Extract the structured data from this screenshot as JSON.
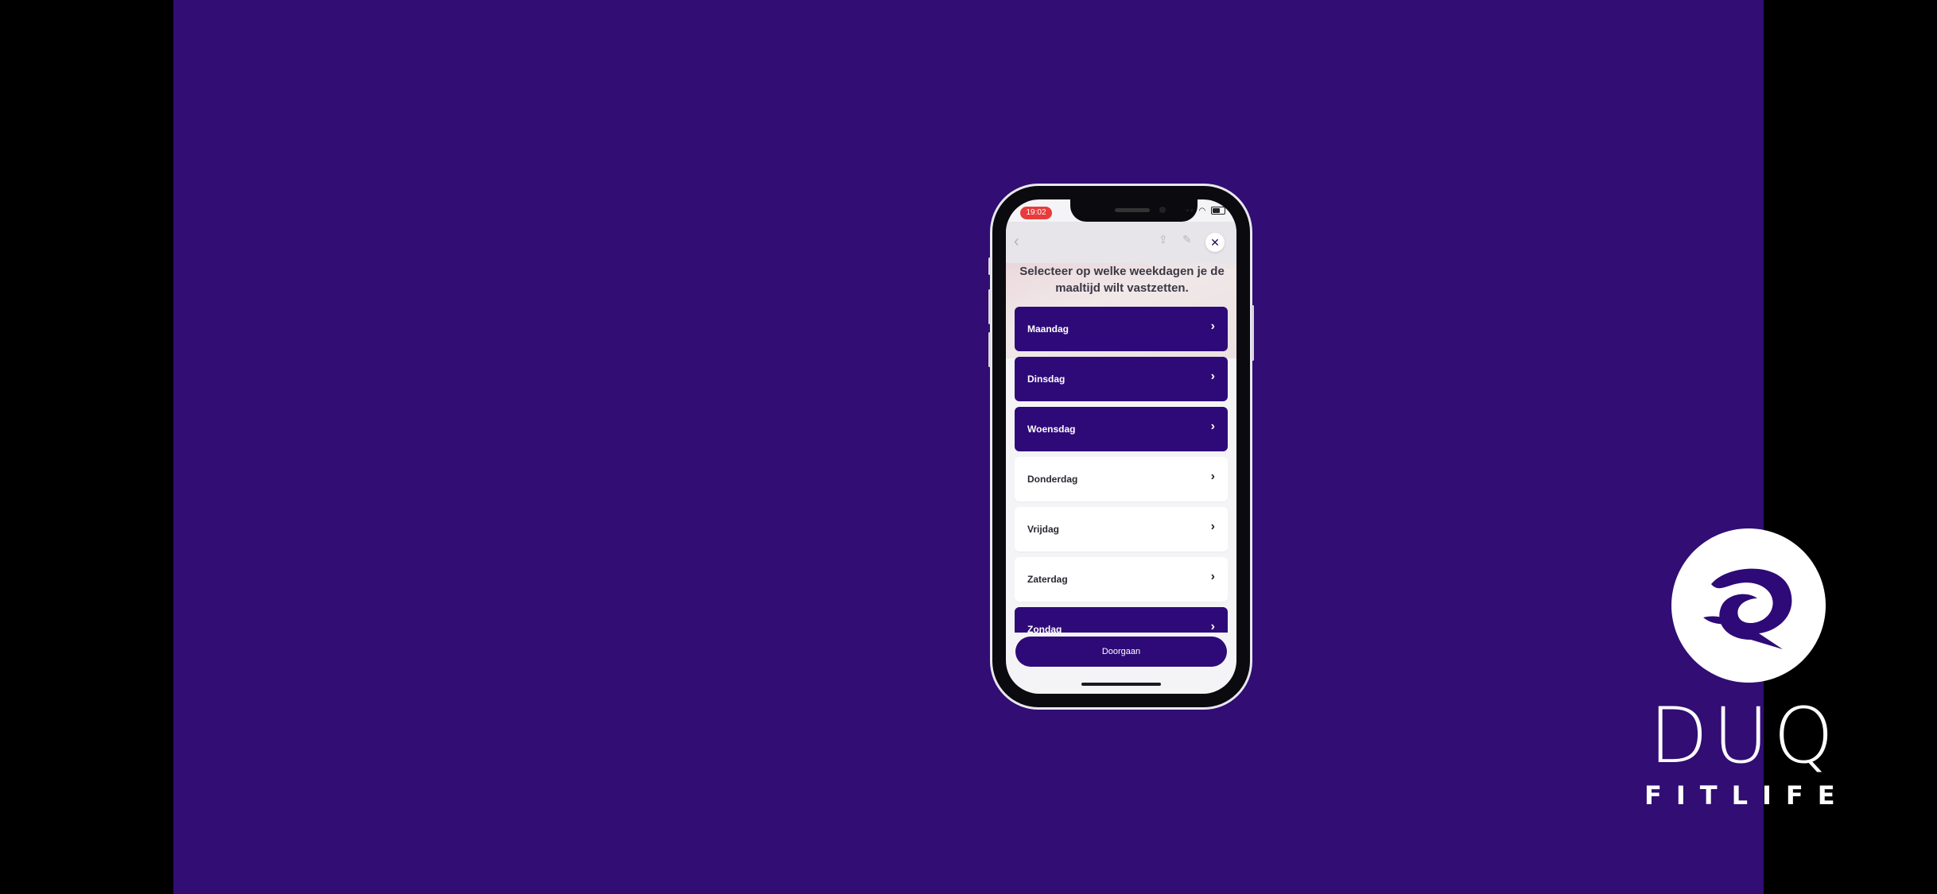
{
  "status_bar": {
    "time": "19:02"
  },
  "sheet": {
    "title": "Selecteer op welke weekdagen je de maaltijd wilt vastzetten.",
    "days": [
      {
        "label": "Maandag",
        "selected": true
      },
      {
        "label": "Dinsdag",
        "selected": true
      },
      {
        "label": "Woensdag",
        "selected": true
      },
      {
        "label": "Donderdag",
        "selected": false
      },
      {
        "label": "Vrijdag",
        "selected": false
      },
      {
        "label": "Zaterdag",
        "selected": false
      },
      {
        "label": "Zondag",
        "selected": true
      }
    ],
    "continue_label": "Doorgaan"
  },
  "brand": {
    "name": "DUQ",
    "tagline": "FITLIFE"
  },
  "colors": {
    "background": "#310d74",
    "primary": "#2e0a78",
    "status_pill": "#e83b3b"
  },
  "icons": [
    "back-chevron-icon",
    "share-icon",
    "edit-icon",
    "close-icon",
    "chevron-right-icon",
    "wifi-icon",
    "battery-icon",
    "duq-logo-icon"
  ]
}
